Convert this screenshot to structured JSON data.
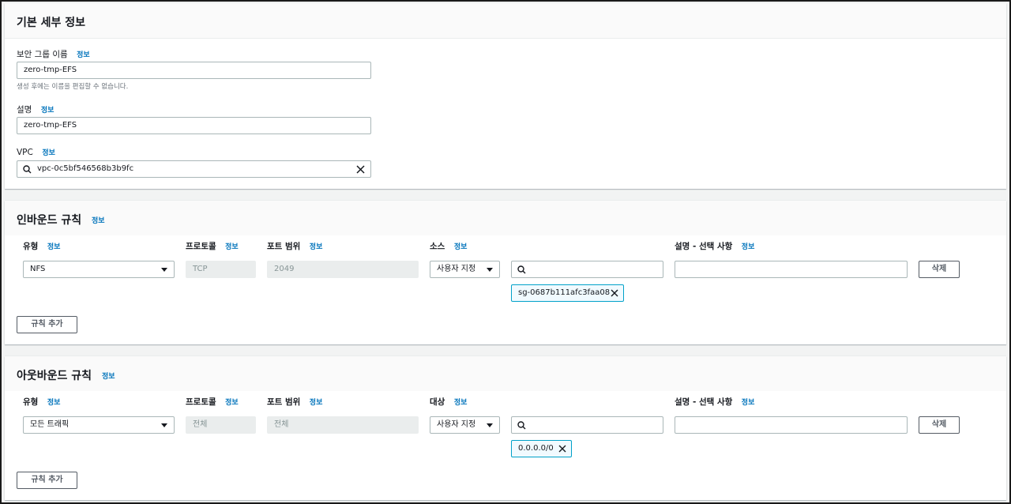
{
  "info": "정보",
  "basic": {
    "title": "기본 세부 정보",
    "sg_name_label": "보안 그룹 이름",
    "sg_name_value": "zero-tmp-EFS",
    "sg_name_hint": "생성 후에는 이름을 편집할 수 없습니다.",
    "desc_label": "설명",
    "desc_value": "zero-tmp-EFS",
    "vpc_label": "VPC",
    "vpc_value": "vpc-0c5bf546568b3b9fc"
  },
  "inbound": {
    "title": "인바운드 규칙",
    "col_type": "유형",
    "col_protocol": "프로토콜",
    "col_port": "포트 범위",
    "col_source": "소스",
    "col_desc": "설명 - 선택 사항",
    "rule": {
      "type": "NFS",
      "protocol": "TCP",
      "port": "2049",
      "source_mode": "사용자 지정",
      "search_value": "",
      "desc_value": "",
      "token": "sg-0687b111afc3faa08"
    },
    "delete_label": "삭제",
    "add_label": "규칙 추가"
  },
  "outbound": {
    "title": "아웃바운드 규칙",
    "col_type": "유형",
    "col_protocol": "프로토콜",
    "col_port": "포트 범위",
    "col_dest": "대상",
    "col_desc": "설명 - 선택 사항",
    "rule": {
      "type": "모든 트래픽",
      "protocol": "전체",
      "port": "전체",
      "dest_mode": "사용자 지정",
      "search_value": "",
      "desc_value": "",
      "token": "0.0.0.0/0"
    },
    "delete_label": "삭제",
    "add_label": "규칙 추가"
  }
}
